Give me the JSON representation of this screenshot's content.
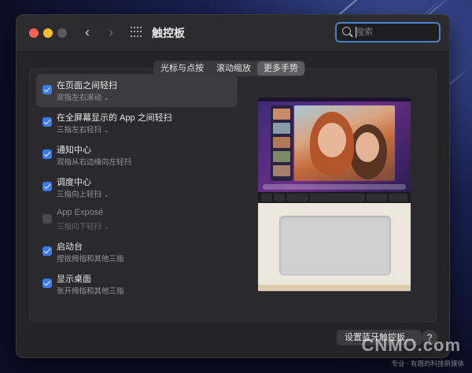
{
  "window": {
    "title": "触控板",
    "nav_back": "‹",
    "nav_forward": "›",
    "search_placeholder": "搜索"
  },
  "tabs": [
    {
      "label": "光标与点按",
      "active": false
    },
    {
      "label": "滚动缩放",
      "active": false
    },
    {
      "label": "更多手势",
      "active": true
    }
  ],
  "gestures": [
    {
      "title": "在页面之间轻扫",
      "subtitle": "双指左右滚动",
      "checked": true,
      "has_menu": true
    },
    {
      "title": "在全屏幕显示的 App 之间轻扫",
      "subtitle": "三指左右轻扫",
      "checked": true,
      "has_menu": true
    },
    {
      "title": "通知中心",
      "subtitle": "双指从右边缘向左轻扫",
      "checked": true,
      "has_menu": false
    },
    {
      "title": "调度中心",
      "subtitle": "三指向上轻扫",
      "checked": true,
      "has_menu": true
    },
    {
      "title": "App Exposé",
      "subtitle": "三指向下轻扫",
      "checked": false,
      "has_menu": true
    },
    {
      "title": "启动台",
      "subtitle": "捏拢拇指和其他三指",
      "checked": true,
      "has_menu": false
    },
    {
      "title": "显示桌面",
      "subtitle": "张开拇指和其他三指",
      "checked": true,
      "has_menu": false
    }
  ],
  "footer": {
    "bluetooth_button": "设置蓝牙触控板…",
    "help_button": "?"
  },
  "watermark": {
    "brand": "CNMO.com",
    "tagline": "专业 · 有趣的科技新媒体"
  },
  "icons": {
    "chevron": "⌄"
  },
  "colors": {
    "accent": "#3b7ae8",
    "close": "#ff5f57",
    "minimize": "#febc2e"
  }
}
